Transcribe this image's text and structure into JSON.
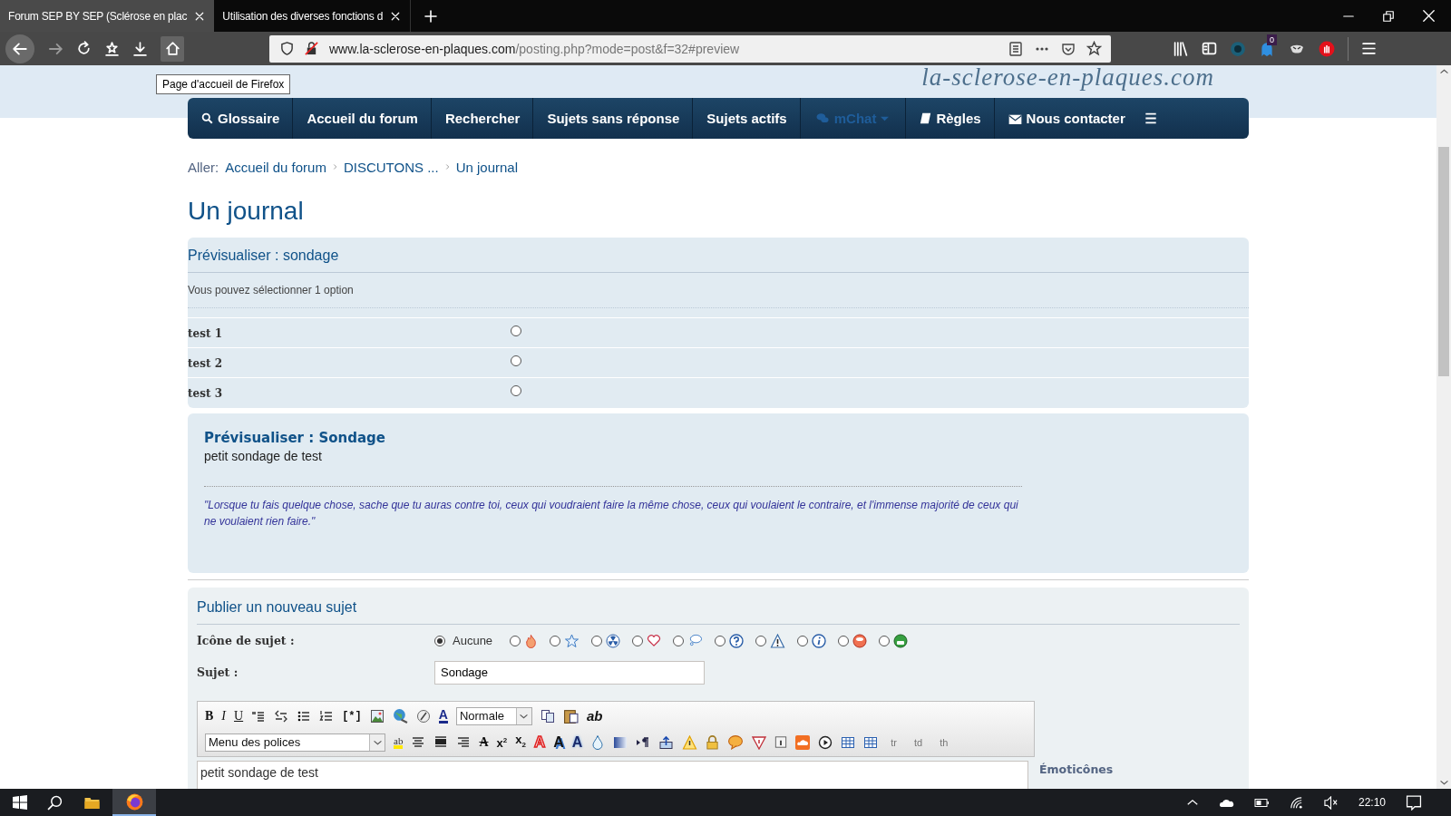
{
  "browser": {
    "tabs": [
      {
        "title": "Forum SEP BY SEP (Sclérose en plac",
        "selected": true
      },
      {
        "title": "Utilisation des diverses fonctions d",
        "selected": false
      }
    ],
    "url": {
      "domain": "www.la-sclerose-en-plaques.com",
      "path": "/posting.php?mode=post&f=32#preview"
    },
    "extension_badge": "0",
    "tooltip": "Page d'accueil de Firefox"
  },
  "site": {
    "logo": "la-sclerose-en-plaques.com",
    "nav": [
      {
        "kind": "search",
        "label": "Glossaire",
        "dimmed": false
      },
      {
        "kind": "link",
        "label": "Accueil du forum",
        "dimmed": false
      },
      {
        "kind": "link",
        "label": "Rechercher",
        "dimmed": false
      },
      {
        "kind": "link",
        "label": "Sujets sans réponse",
        "dimmed": false
      },
      {
        "kind": "link",
        "label": "Sujets actifs",
        "dimmed": false
      },
      {
        "kind": "chat",
        "label": "mChat",
        "dimmed": true
      },
      {
        "kind": "book",
        "label": "Règles",
        "dimmed": false
      },
      {
        "kind": "mail",
        "label": "Nous contacter",
        "dimmed": false
      },
      {
        "kind": "menu",
        "dimmed": false
      }
    ]
  },
  "breadcrumb": {
    "prefix": "Aller:",
    "items": [
      "Accueil du forum",
      "DISCUTONS ...",
      "Un journal"
    ]
  },
  "page_title": "Un journal",
  "poll": {
    "heading": "Prévisualiser : sondage",
    "note": "Vous pouvez sélectionner 1 option",
    "options": [
      {
        "label": "test 1",
        "selected": false
      },
      {
        "label": "test 2",
        "selected": false
      },
      {
        "label": "test 3",
        "selected": false
      }
    ]
  },
  "preview": {
    "title": "Prévisualiser : Sondage",
    "body": "petit sondage de test",
    "signature": "\"Lorsque tu fais quelque chose, sache que tu auras contre toi, ceux qui voudraient faire la même chose, ceux qui voulaient le contraire, et l'immense majorité de ceux qui ne voulaient rien faire.\""
  },
  "post_form": {
    "heading": "Publier un nouveau sujet",
    "icon_label": "Icône de sujet :",
    "topic_icons": [
      {
        "kind": "none",
        "label": "Aucune",
        "selected": true
      },
      {
        "kind": "fire",
        "selected": false
      },
      {
        "kind": "star",
        "selected": false
      },
      {
        "kind": "trefoil",
        "selected": false
      },
      {
        "kind": "heart",
        "selected": false
      },
      {
        "kind": "thought",
        "selected": false
      },
      {
        "kind": "question",
        "selected": false
      },
      {
        "kind": "warning",
        "selected": false
      },
      {
        "kind": "info",
        "selected": false
      },
      {
        "kind": "ball",
        "selected": false
      },
      {
        "kind": "green-ball",
        "selected": false
      }
    ],
    "subject_label": "Sujet :",
    "subject_value": "Sondage",
    "toolbar_rows": [
      [
        {
          "kind": "bold",
          "label": "B"
        },
        {
          "kind": "italic",
          "label": "I"
        },
        {
          "kind": "underline",
          "label": "U"
        },
        {
          "kind": "quote"
        },
        {
          "kind": "code"
        },
        {
          "kind": "bullets"
        },
        {
          "kind": "numbers"
        },
        {
          "kind": "plain",
          "label": "[*]"
        },
        {
          "kind": "image"
        },
        {
          "kind": "globe"
        },
        {
          "kind": "disc"
        },
        {
          "kind": "color",
          "label": "A"
        },
        {
          "kind": "select",
          "value": "Normale"
        },
        {
          "kind": "copy"
        },
        {
          "kind": "clipboard"
        },
        {
          "kind": "bolditalic",
          "label": "ab"
        }
      ],
      [
        {
          "kind": "select",
          "value": "Menu des polices"
        },
        {
          "kind": "highlight",
          "label": "ab"
        },
        {
          "kind": "center"
        },
        {
          "kind": "justify"
        },
        {
          "kind": "right"
        },
        {
          "kind": "strike",
          "label": "A"
        },
        {
          "kind": "sup",
          "label": "x$^{2}$"
        },
        {
          "kind": "sub",
          "label": "x$_{2}$"
        },
        {
          "kind": "outline",
          "label": "A"
        },
        {
          "kind": "shadow",
          "label": "A"
        },
        {
          "kind": "glow",
          "label": "A"
        },
        {
          "kind": "drop"
        },
        {
          "kind": "gradient"
        },
        {
          "kind": "direction"
        },
        {
          "kind": "upload"
        },
        {
          "kind": "warning"
        },
        {
          "kind": "lock"
        },
        {
          "kind": "speech"
        },
        {
          "kind": "triangle"
        },
        {
          "kind": "document"
        },
        {
          "kind": "cloud"
        },
        {
          "kind": "play"
        },
        {
          "kind": "table"
        },
        {
          "kind": "table"
        },
        {
          "kind": "small",
          "label": "tr"
        },
        {
          "kind": "small",
          "label": "td"
        },
        {
          "kind": "small",
          "label": "th"
        }
      ]
    ],
    "message": "petit sondage de test",
    "smilies_label": "Émoticônes"
  },
  "taskbar": {
    "time": "22:10"
  }
}
